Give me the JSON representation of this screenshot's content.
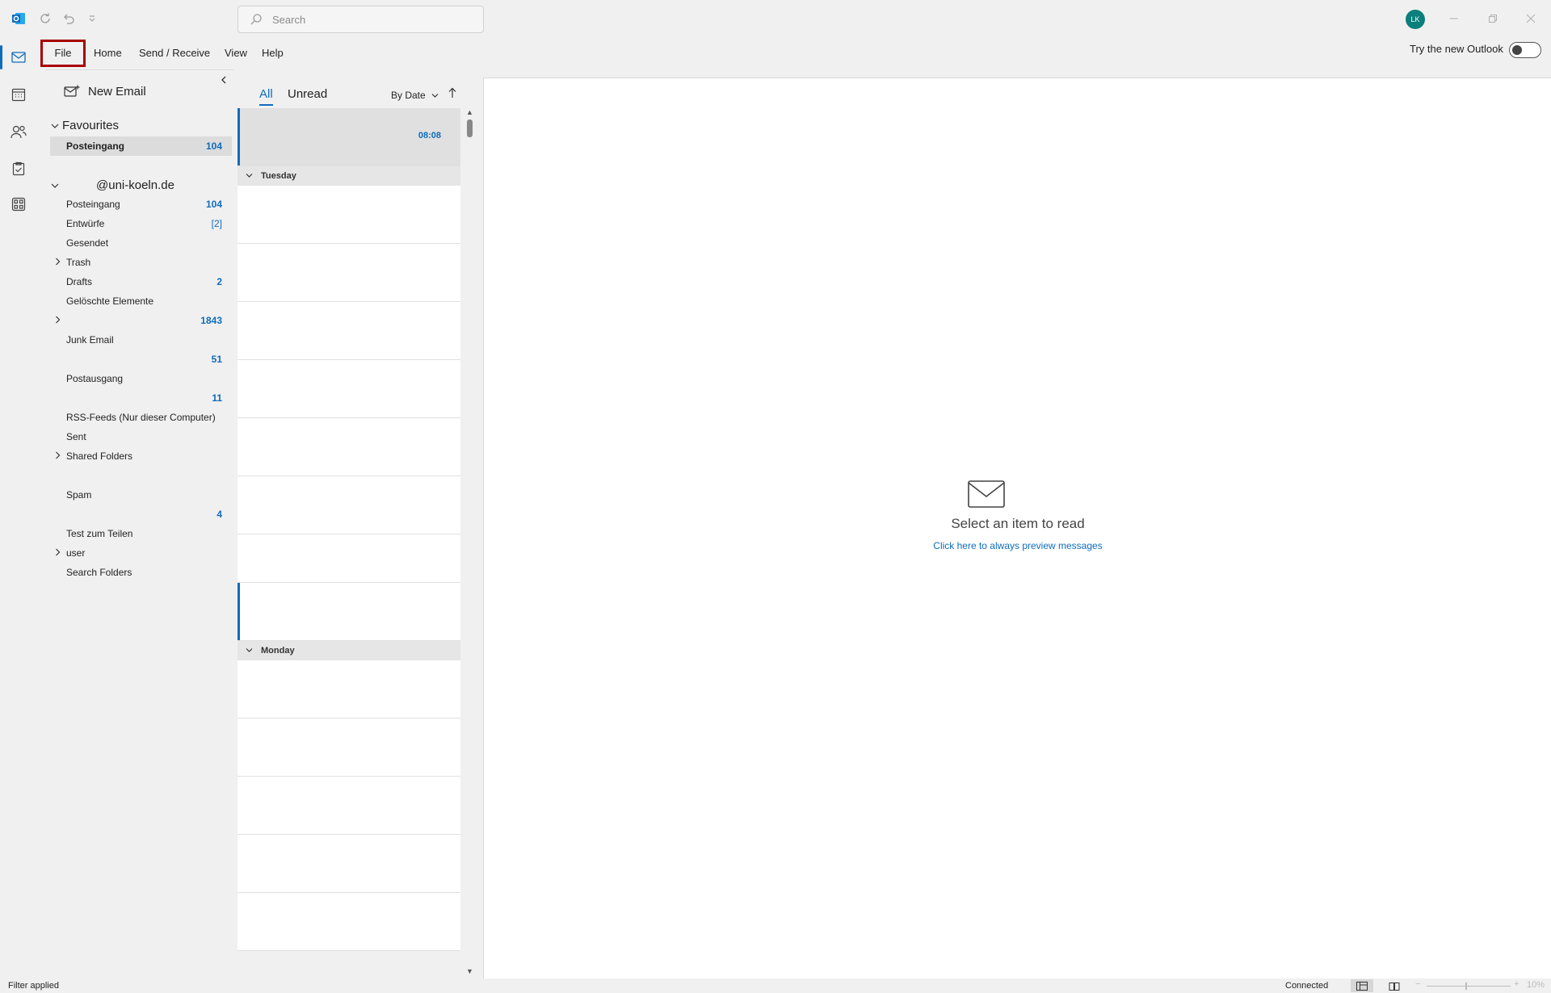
{
  "titlebar": {
    "search_placeholder": "Search",
    "avatar_initials": "LK"
  },
  "menu": {
    "file": "File",
    "home": "Home",
    "send_receive": "Send / Receive",
    "view": "View",
    "help": "Help",
    "try_new_outlook": "Try the new Outlook"
  },
  "folders": {
    "new_email": "New Email",
    "favourites_label": "Favourites",
    "favourites": [
      {
        "label": "Posteingang",
        "count": "104"
      }
    ],
    "account_label": "@uni-koeln.de",
    "items": [
      {
        "label": "Posteingang",
        "count": "104"
      },
      {
        "label": "Entwürfe",
        "count": "[2]"
      },
      {
        "label": "Gesendet",
        "count": ""
      },
      {
        "label": "Trash",
        "count": ""
      },
      {
        "label": "Drafts",
        "count": "2"
      },
      {
        "label": "Gelöschte Elemente",
        "count": ""
      },
      {
        "label": "",
        "count": "1843"
      },
      {
        "label": "Junk Email",
        "count": ""
      },
      {
        "label": "",
        "count": "51"
      },
      {
        "label": "Postausgang",
        "count": ""
      },
      {
        "label": "",
        "count": "11"
      },
      {
        "label": "RSS-Feeds (Nur dieser Computer)",
        "count": ""
      },
      {
        "label": "Sent",
        "count": ""
      },
      {
        "label": "Shared Folders",
        "count": ""
      },
      {
        "label": "",
        "count": ""
      },
      {
        "label": "Spam",
        "count": ""
      },
      {
        "label": "",
        "count": "4"
      },
      {
        "label": "Test zum Teilen",
        "count": ""
      },
      {
        "label": "user",
        "count": ""
      },
      {
        "label": "Search Folders",
        "count": ""
      }
    ]
  },
  "message_list": {
    "tab_all": "All",
    "tab_unread": "Unread",
    "sort_label": "By Date",
    "first_item_time": "08:08",
    "group_tuesday": "Tuesday",
    "group_monday": "Monday"
  },
  "reading_pane": {
    "select_item": "Select an item to read",
    "preview_link": "Click here to always preview messages"
  },
  "statusbar": {
    "filter": "Filter applied",
    "connection": "Connected",
    "zoom": "10%"
  },
  "colors": {
    "accent": "#0f6cbd",
    "file_highlight": "#a80000",
    "avatar": "#0b7f7b"
  }
}
